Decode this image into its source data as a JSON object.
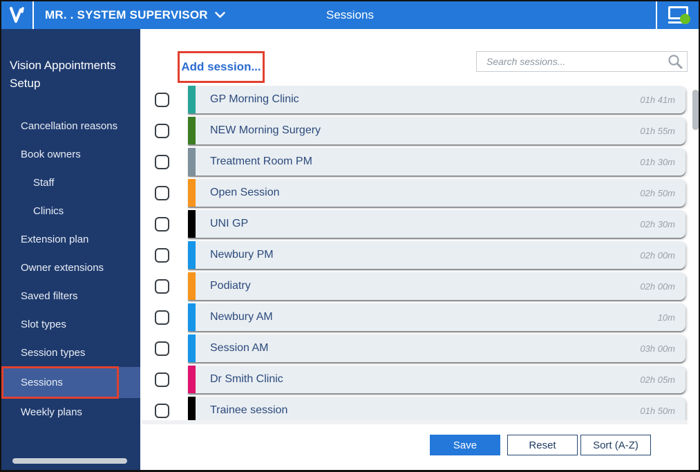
{
  "topbar": {
    "user_label": "MR. . SYSTEM SUPERVISOR",
    "title": "Sessions",
    "status_color": "#6abf23"
  },
  "sidebar": {
    "title": "Vision Appointments Setup",
    "items": [
      {
        "label": "Cancellation reasons",
        "indent": 0,
        "selected": false
      },
      {
        "label": "Book owners",
        "indent": 0,
        "selected": false
      },
      {
        "label": "Staff",
        "indent": 1,
        "selected": false
      },
      {
        "label": "Clinics",
        "indent": 1,
        "selected": false
      },
      {
        "label": "Extension plan",
        "indent": 0,
        "selected": false
      },
      {
        "label": "Owner extensions",
        "indent": 0,
        "selected": false
      },
      {
        "label": "Saved filters",
        "indent": 0,
        "selected": false
      },
      {
        "label": "Slot types",
        "indent": 0,
        "selected": false
      },
      {
        "label": "Session types",
        "indent": 0,
        "selected": false
      },
      {
        "label": "Sessions",
        "indent": 0,
        "selected": true,
        "annotated": true
      },
      {
        "label": "Weekly plans",
        "indent": 0,
        "selected": false
      }
    ]
  },
  "main": {
    "add_session_label": "Add session...",
    "search_placeholder": "Search sessions...",
    "sessions": [
      {
        "name": "GP Morning Clinic",
        "duration": "01h 41m",
        "color": "#26a599"
      },
      {
        "name": "NEW Morning Surgery",
        "duration": "01h 55m",
        "color": "#3c7d21"
      },
      {
        "name": "Treatment Room PM",
        "duration": "01h 30m",
        "color": "#7e909c"
      },
      {
        "name": "Open Session",
        "duration": "02h 50m",
        "color": "#f7941d"
      },
      {
        "name": "UNI GP",
        "duration": "02h 30m",
        "color": "#000000"
      },
      {
        "name": "Newbury PM",
        "duration": "02h 00m",
        "color": "#1795e8"
      },
      {
        "name": "Podiatry",
        "duration": "02h 00m",
        "color": "#f7941d"
      },
      {
        "name": "Newbury AM",
        "duration": "10m",
        "color": "#1795e8"
      },
      {
        "name": "Session AM",
        "duration": "03h 00m",
        "color": "#1795e8"
      },
      {
        "name": "Dr Smith Clinic",
        "duration": "02h 05m",
        "color": "#e0136e"
      },
      {
        "name": "Trainee session",
        "duration": "01h 50m",
        "color": "#000000"
      }
    ],
    "footer": {
      "save_label": "Save",
      "reset_label": "Reset",
      "sort_label": "Sort (A-Z)"
    }
  },
  "colors": {
    "topbar_blue": "#2478d9",
    "sidebar_navy": "#1e3a6d",
    "selected_item": "#3f5d9b",
    "annotation_red": "#e2402f",
    "row_background": "#e9eef2"
  }
}
